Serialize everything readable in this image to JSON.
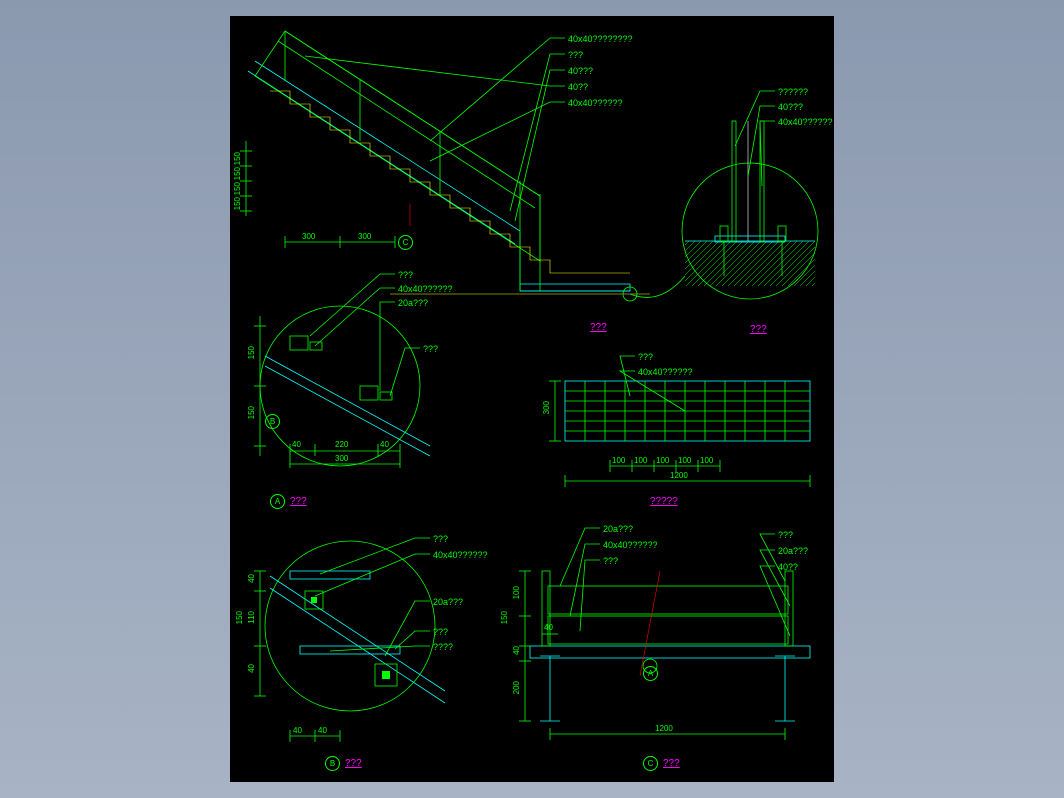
{
  "main": {
    "title": "???",
    "labels": [
      "40x40????????",
      "???",
      "40???",
      "40??",
      "40x40??????"
    ],
    "dims_v": [
      "150",
      "150",
      "150",
      "150"
    ],
    "dims_h": [
      "300",
      "300"
    ]
  },
  "detail_c_top": {
    "title": "???",
    "labels": [
      "??????",
      "40???",
      "40x40??????"
    ]
  },
  "detail_a": {
    "title": "???",
    "labels": [
      "???",
      "40x40??????",
      "20a???",
      "???"
    ],
    "dims_v": [
      "150",
      "150"
    ],
    "dims_h": [
      "40",
      "220",
      "40",
      "300"
    ]
  },
  "grate": {
    "title": "?????",
    "labels": [
      "???",
      "40x40??????"
    ],
    "dims_v": [
      "300"
    ],
    "dims_h": [
      "100",
      "100",
      "100",
      "100",
      "100",
      "1200"
    ]
  },
  "detail_b": {
    "title": "???",
    "labels": [
      "???",
      "40x40??????",
      "20a???",
      "???",
      "????"
    ],
    "dims_v": [
      "40",
      "110",
      "150",
      "40"
    ],
    "dims_h": [
      "40",
      "40"
    ]
  },
  "section_c": {
    "title": "???",
    "labels_l": [
      "20a???",
      "40x40??????",
      "???"
    ],
    "labels_r": [
      "???",
      "20a???",
      "40??"
    ],
    "dims_v": [
      "100",
      "150",
      "40",
      "200"
    ],
    "dims_h": [
      "40",
      "1200"
    ]
  }
}
